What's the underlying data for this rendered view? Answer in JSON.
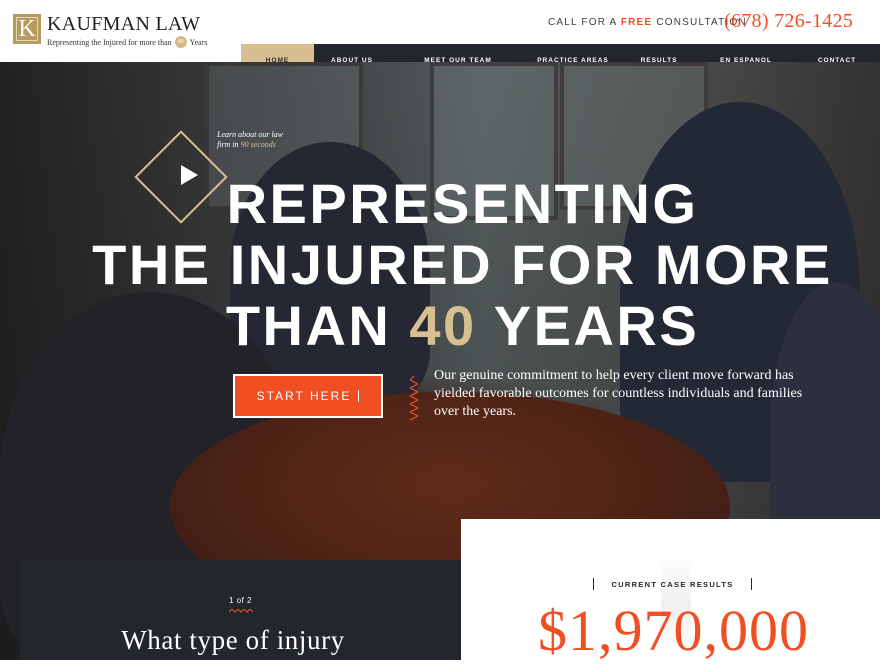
{
  "header": {
    "logo": {
      "mark_letter": "K",
      "name": "KAUFMAN LAW",
      "tagline_start": "Representing the Injured for more than",
      "tagline_badge": "40",
      "tagline_end": "Years"
    },
    "cta_prefix": "CALL FOR A",
    "cta_free": "FREE",
    "cta_suffix": "CONSULTATION",
    "phone": "(678) 726-1425"
  },
  "nav": {
    "items": [
      {
        "label": "HOME",
        "active": true
      },
      {
        "label": "ABOUT US",
        "dropdown": true
      },
      {
        "label": "MEET OUR TEAM",
        "dropdown": true
      },
      {
        "label": "PRACTICE AREAS",
        "dropdown": true
      },
      {
        "label": "RESULTS"
      },
      {
        "label": "EN ESPANOL"
      },
      {
        "label": "CONTACT"
      }
    ]
  },
  "hero": {
    "video_line1": "Learn about our law",
    "video_line2_start": "firm in",
    "video_line2_highlight": "90 seconds",
    "headline_line1": "REPRESENTING",
    "headline_line2": "THE INJURED FOR MORE",
    "headline_line3_start": "THAN",
    "headline_line3_highlight": "40",
    "headline_line3_end": "YEARS",
    "cta_button": "START HERE",
    "description": "Our genuine commitment to help every client move forward has yielded favorable outcomes for countless individuals and families over the years."
  },
  "questionnaire": {
    "step": "1 of 2",
    "question": "What type of injury"
  },
  "case_results": {
    "label": "CURRENT CASE RESULTS",
    "amount": "$1,970,000"
  },
  "colors": {
    "accent_orange": "#f04e23",
    "accent_gold": "#d8bf91",
    "dark": "#23262b"
  }
}
